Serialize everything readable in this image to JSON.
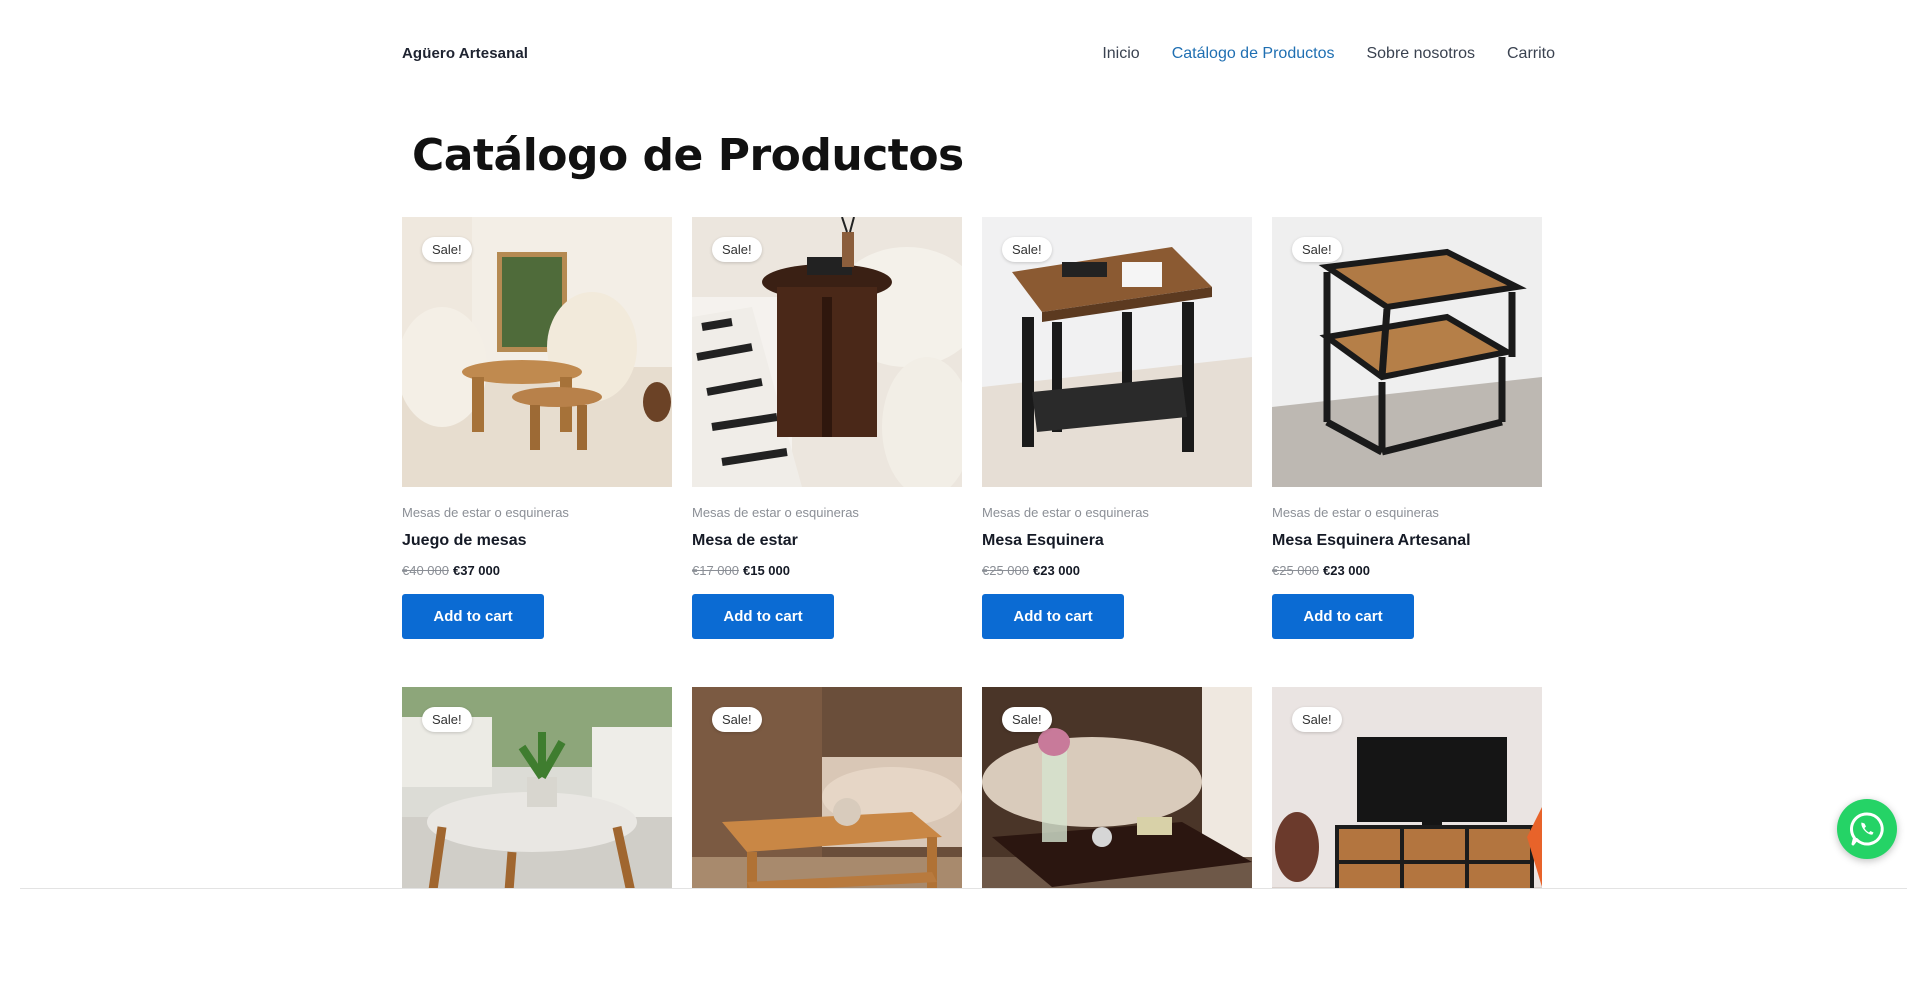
{
  "header": {
    "site_title": "Agüero Artesanal",
    "nav": [
      {
        "label": "Inicio",
        "active": false
      },
      {
        "label": "Catálogo de Productos",
        "active": true
      },
      {
        "label": "Sobre nosotros",
        "active": false
      },
      {
        "label": "Carrito",
        "active": false
      }
    ]
  },
  "page": {
    "title": "Catálogo de Productos"
  },
  "colors": {
    "accent": "#0b6bd3",
    "nav_active": "#1f6fb2",
    "whatsapp": "#25d366"
  },
  "products": [
    {
      "badge": "Sale!",
      "category": "Mesas de estar o esquineras",
      "name": "Juego de mesas",
      "old_price": "€40 000",
      "price": "€37 000",
      "button": "Add to cart",
      "image_icon": "coffee-table-set-image"
    },
    {
      "badge": "Sale!",
      "category": "Mesas de estar o esquineras",
      "name": "Mesa de estar",
      "old_price": "€17 000",
      "price": "€15 000",
      "button": "Add to cart",
      "image_icon": "round-side-table-image"
    },
    {
      "badge": "Sale!",
      "category": "Mesas de estar o esquineras",
      "name": "Mesa Esquinera",
      "old_price": "€25 000",
      "price": "€23 000",
      "button": "Add to cart",
      "image_icon": "corner-table-image"
    },
    {
      "badge": "Sale!",
      "category": "Mesas de estar o esquineras",
      "name": "Mesa Esquinera Artesanal",
      "old_price": "€25 000",
      "price": "€23 000",
      "button": "Add to cart",
      "image_icon": "stacked-table-image"
    },
    {
      "badge": "Sale!",
      "image_icon": "round-coffee-table-image"
    },
    {
      "badge": "Sale!",
      "image_icon": "wood-coffee-table-image"
    },
    {
      "badge": "Sale!",
      "image_icon": "dark-coffee-table-image"
    },
    {
      "badge": "Sale!",
      "image_icon": "tv-stand-image"
    }
  ],
  "whatsapp": {
    "icon": "whatsapp-icon"
  }
}
